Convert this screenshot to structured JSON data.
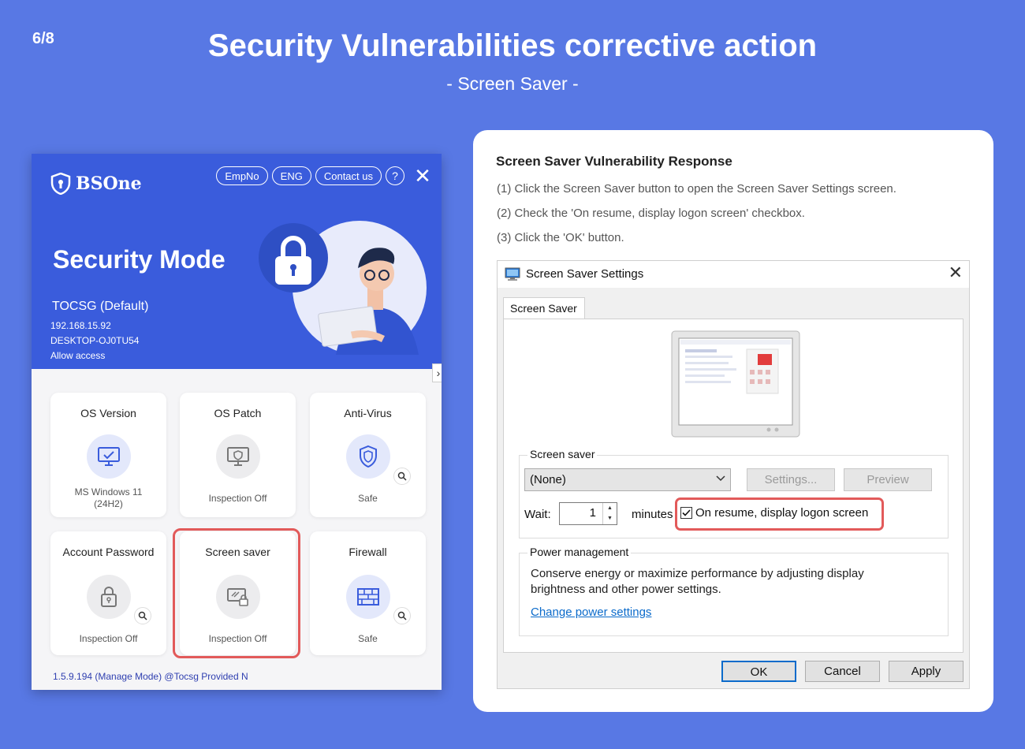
{
  "slide": {
    "page": "6/8",
    "title": "Security Vulnerabilities corrective action",
    "subtitle": "- Screen Saver -"
  },
  "bsone": {
    "logo": "BSOne",
    "top_buttons": [
      "EmpNo",
      "ENG",
      "Contact us"
    ],
    "help": "?",
    "close": "✕",
    "mode": "Security Mode",
    "policy": "TOCSG (Default)",
    "ip": "192.168.15.92",
    "host": "DESKTOP-OJ0TU54",
    "access": "Allow access",
    "expand": "›",
    "cards": [
      {
        "title": "OS Version",
        "status": "MS Windows 11\n(24H2)",
        "icon": "monitor-check-icon"
      },
      {
        "title": "OS Patch",
        "status": "Inspection Off",
        "icon": "monitor-shield-icon"
      },
      {
        "title": "Anti-Virus",
        "status": "Safe",
        "icon": "shield-icon"
      },
      {
        "title": "Account Password",
        "status": "Inspection Off",
        "icon": "lock-icon"
      },
      {
        "title": "Screen saver",
        "status": "Inspection Off",
        "icon": "screen-lock-icon"
      },
      {
        "title": "Firewall",
        "status": "Safe",
        "icon": "brick-wall-icon"
      }
    ],
    "version": "1.5.9.194 (Manage Mode) @Tocsg Provided N",
    "colors": {
      "header": "#3a5cdc",
      "highlight": "#e25a5a"
    }
  },
  "instructions": {
    "title": "Screen Saver Vulnerability Response",
    "steps": [
      "(1) Click the Screen Saver button to open the Screen Saver Settings screen.",
      "(2) Check the 'On resume, display logon screen' checkbox.",
      "(3) Click the 'OK' button."
    ]
  },
  "dialog": {
    "title": "Screen Saver Settings",
    "close": "✕",
    "tab": "Screen Saver",
    "screen_saver_group": "Screen saver",
    "selected": "(None)",
    "settings_btn": "Settings...",
    "preview_btn": "Preview",
    "wait_label": "Wait:",
    "wait_value": "1",
    "minutes": "minutes",
    "resume_label": "On resume, display logon screen",
    "resume_checked": true,
    "power_group": "Power management",
    "power_text": "Conserve energy or maximize performance by adjusting display brightness and other power settings.",
    "power_link": "Change power settings",
    "ok": "OK",
    "cancel": "Cancel",
    "apply": "Apply"
  }
}
